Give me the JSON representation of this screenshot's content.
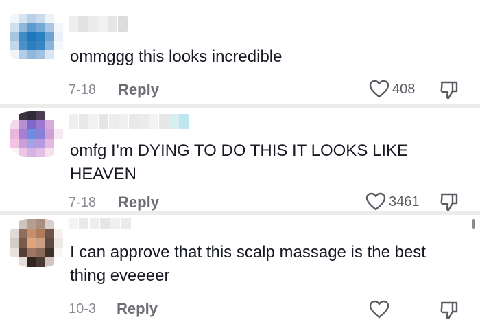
{
  "comments": [
    {
      "text": "ommggg this looks incredible",
      "date": "7-18",
      "reply_label": "Reply",
      "likes": "408",
      "avatar_colors": [
        "#f2f6fa",
        "#d6e4f1",
        "#b8d0e8",
        "#c9dbed",
        "#eef3f8",
        "#ffffff",
        "#cfe0f0",
        "#8fb6dc",
        "#5d9acd",
        "#74a8d5",
        "#a9c7e4",
        "#f4f7fa",
        "#a5c6e3",
        "#3f8bc7",
        "#1f78bd",
        "#2a80c1",
        "#6ba3d3",
        "#e9f0f7",
        "#c3d8ec",
        "#4b90c9",
        "#2d7fbf",
        "#3786c3",
        "#8bb4db",
        "#f5f8fb",
        "#eef4f9",
        "#b3cde6",
        "#8fb8dd",
        "#a0c2e1",
        "#d9e6f2",
        "#ffffff"
      ],
      "username_colors": [
        "#eeeeee",
        "#e2e2e2",
        "#ececec",
        "#f2f2f2",
        "#e6e6e6",
        "#dcdcdc"
      ]
    },
    {
      "text": "omfg I’m DYING TO DO THIS IT LOOKS LIKE HEAVEN",
      "date": "7-18",
      "reply_label": "Reply",
      "likes": "3461",
      "avatar_colors": [
        "#ffffff",
        "#3b3340",
        "#2f2a36",
        "#4a3d52",
        "#ffffff",
        "#ffffff",
        "#f3d7ea",
        "#b58fd0",
        "#7e68c9",
        "#9c78cf",
        "#d8a9d9",
        "#ffffff",
        "#e9b6dc",
        "#a77fd5",
        "#6c8de0",
        "#8a7fd6",
        "#cf9fd6",
        "#f7e8f2",
        "#f2c4e2",
        "#c99ed9",
        "#a2a2e4",
        "#b89ae0",
        "#e5b9df",
        "#ffffff",
        "#fdf1f8",
        "#ecc6e4",
        "#d6b3e4",
        "#e2bfe5",
        "#f6e1ef",
        "#ffffff"
      ],
      "username_colors": [
        "#efefef",
        "#e8e8e8",
        "#f1f1f1",
        "#e5e5e5",
        "#ededed",
        "#f0f0f0",
        "#e9e9e9",
        "#ebebeb",
        "#f3f3f3",
        "#e7e7e7",
        "#d7eef2",
        "#bfe6ee"
      ]
    },
    {
      "text": "I can approve that this scalp massage is the best thing eveeeer",
      "date": "10-3",
      "reply_label": "Reply",
      "likes": "",
      "avatar_colors": [
        "#ffffff",
        "#cfc3bd",
        "#b59d90",
        "#a98f82",
        "#d8cfca",
        "#ffffff",
        "#e2d9d4",
        "#8f6e5f",
        "#c58e6c",
        "#b07a5c",
        "#6f5549",
        "#f4f0ee",
        "#d6ccc6",
        "#7a5a4b",
        "#e0a37e",
        "#caa085",
        "#5d4a42",
        "#efe9e6",
        "#e8e1dd",
        "#564036",
        "#9e7763",
        "#8a6a5a",
        "#3f3029",
        "#f8f5f3",
        "#ffffff",
        "#e5ddd8",
        "#2f241f",
        "#4a3a32",
        "#d2c5be",
        "#ffffff"
      ],
      "username_colors": [
        "#f3f3f3",
        "#e9e9e9",
        "#eeeeee",
        "#e6e6e6",
        "#f0f0f0",
        "#ebebeb"
      ]
    }
  ],
  "icons": {
    "like": "heart-outline",
    "dislike": "thumbs-down-outline"
  },
  "colors": {
    "text": "#161823",
    "meta": "#8a8b91",
    "separator": "#ececec"
  }
}
